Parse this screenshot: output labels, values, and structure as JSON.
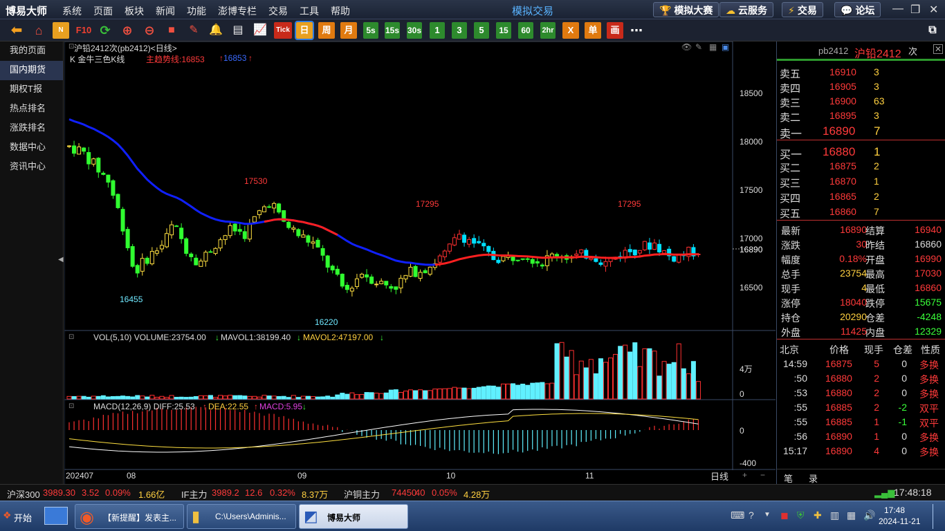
{
  "app": {
    "name": "博易大师",
    "mode": "模拟交易",
    "menu": [
      "系统",
      "页面",
      "板块",
      "新闻",
      "功能",
      "澎博专栏",
      "交易",
      "工具",
      "帮助"
    ],
    "top_buttons": [
      "模拟大赛",
      "云服务",
      "交易",
      "论坛"
    ]
  },
  "toolbar": {
    "periods": [
      "Tick",
      "日",
      "周",
      "月",
      "5s",
      "15s",
      "30s",
      "1",
      "3",
      "5",
      "15",
      "60",
      "2hr",
      "X",
      "单",
      "画"
    ],
    "selected_period": "日"
  },
  "sidebar": {
    "items": [
      "我的页面",
      "国内期货",
      "期权T报",
      "热点排名",
      "涨跌排名",
      "数据中心",
      "资讯中心"
    ],
    "active": "国内期货"
  },
  "chart": {
    "header": "沪铅2412次(pb2412)<日线>",
    "indicator_line": "K 金牛三色K线",
    "trend_label": "主趋势线:16853",
    "trend_value2": "16853",
    "annotations": {
      "high1": "17530",
      "high2": "17295",
      "high3": "17295",
      "low1": "16455",
      "low2": "16220"
    },
    "price_axis": [
      "18500",
      "18000",
      "17500",
      "17000",
      "16500"
    ],
    "current_price": "16890",
    "volume_header": "VOL(5,10) VOLUME:23754.00",
    "volume_ma1": "MAVOL1:38199.40",
    "volume_ma2": "MAVOL2:47197.00",
    "volume_axis": [
      "4万",
      "0"
    ],
    "macd_header": "MACD(12,26,9) DIFF:25.53",
    "macd_dea": "DEA:22.55",
    "macd_val": "MACD:5.95",
    "macd_axis": [
      "0",
      "-400"
    ],
    "date_axis": [
      "202407",
      "08",
      "09",
      "10",
      "11"
    ],
    "period_tab": "日线"
  },
  "chart_data": {
    "type": "candlestick",
    "title": "沪铅2412次(pb2412) 日线",
    "ylim": [
      16000,
      18800
    ],
    "trend_line_last": 16853,
    "last_price": 16890,
    "volume_last": 23754,
    "mavol1": 38199.4,
    "mavol2": 47197,
    "macd": {
      "diff": 25.53,
      "dea": 22.55,
      "macd": 5.95
    }
  },
  "quote": {
    "title_code": "pb2412",
    "title_name": "沪铅2412",
    "title_suffix": "次",
    "asks": [
      {
        "label": "卖五",
        "price": "16910",
        "vol": "3"
      },
      {
        "label": "卖四",
        "price": "16905",
        "vol": "3"
      },
      {
        "label": "卖三",
        "price": "16900",
        "vol": "63"
      },
      {
        "label": "卖二",
        "price": "16895",
        "vol": "3"
      },
      {
        "label": "卖一",
        "price": "16890",
        "vol": "7"
      }
    ],
    "bids": [
      {
        "label": "买一",
        "price": "16880",
        "vol": "1"
      },
      {
        "label": "买二",
        "price": "16875",
        "vol": "2"
      },
      {
        "label": "买三",
        "price": "16870",
        "vol": "1"
      },
      {
        "label": "买四",
        "price": "16865",
        "vol": "2"
      },
      {
        "label": "买五",
        "price": "16860",
        "vol": "7"
      }
    ],
    "stats": [
      {
        "l1": "最新",
        "v1": "16890",
        "l2": "结算",
        "v2": "16940"
      },
      {
        "l1": "涨跌",
        "v1": "30",
        "l2": "昨结",
        "v2": "16860"
      },
      {
        "l1": "幅度",
        "v1": "0.18%",
        "l2": "开盘",
        "v2": "16990"
      },
      {
        "l1": "总手",
        "v1": "23754",
        "l2": "最高",
        "v2": "17030"
      },
      {
        "l1": "现手",
        "v1": "4",
        "l2": "最低",
        "v2": "16860"
      },
      {
        "l1": "涨停",
        "v1": "18040",
        "l2": "跌停",
        "v2": "15675"
      },
      {
        "l1": "持仓",
        "v1": "20290",
        "l2": "仓差",
        "v2": "-4248"
      },
      {
        "l1": "外盘",
        "v1": "11425",
        "l2": "内盘",
        "v2": "12329"
      }
    ],
    "trades_header": [
      "北京",
      "价格",
      "现手",
      "仓差",
      "性质"
    ],
    "trades": [
      {
        "t": "14:59",
        "p": "16875",
        "v": "5",
        "d": "0",
        "k": "多换"
      },
      {
        "t": ":50",
        "p": "16880",
        "v": "2",
        "d": "0",
        "k": "多换"
      },
      {
        "t": ":53",
        "p": "16880",
        "v": "2",
        "d": "0",
        "k": "多换"
      },
      {
        "t": ":55",
        "p": "16885",
        "v": "2",
        "d": "-2",
        "k": "双平"
      },
      {
        "t": ":55",
        "p": "16885",
        "v": "1",
        "d": "-1",
        "k": "双平"
      },
      {
        "t": ":56",
        "p": "16890",
        "v": "1",
        "d": "0",
        "k": "多换"
      },
      {
        "t": "15:17",
        "p": "16890",
        "v": "4",
        "d": "0",
        "k": "多换"
      }
    ],
    "tabs": [
      "笔",
      "录"
    ]
  },
  "status": {
    "items": [
      {
        "name": "沪深300",
        "price": "3989.30",
        "chg": "3.52",
        "pct": "0.09%",
        "amt": "1.66亿"
      },
      {
        "name": "IF主力",
        "price": "3989.2",
        "chg": "12.6",
        "pct": "0.32%",
        "amt": "8.37万"
      },
      {
        "name": "沪铜主力",
        "price": "74450",
        "chg": "40",
        "pct": "0.05%",
        "amt": "4.28万"
      }
    ],
    "clock": "17:48:18"
  },
  "taskbar": {
    "start": "开始",
    "tasks": [
      "【新提醒】发表主...",
      "C:\\Users\\Adminis...",
      "博易大师"
    ],
    "time": "17:48",
    "date": "2024-11-21"
  }
}
